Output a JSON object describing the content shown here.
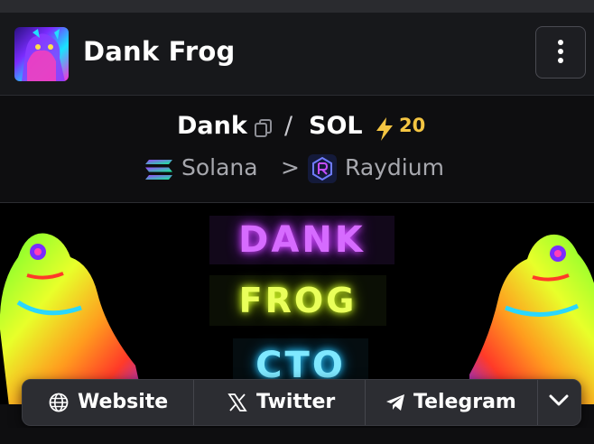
{
  "header": {
    "token_name": "Dank Frog",
    "avatar_icon": "dank-frog-avatar",
    "menu_icon": "more-vertical-icon"
  },
  "pair": {
    "base": "Dank",
    "separator": "/",
    "quote": "SOL",
    "boost_count": "20",
    "boost_color": "#f4c542",
    "copy_icon": "copy-icon",
    "boost_icon": "lightning-bolt-icon"
  },
  "chain": {
    "name": "Solana",
    "chevron": ">",
    "dex": "Raydium",
    "chain_icon": "solana-icon",
    "dex_icon": "raydium-icon"
  },
  "banner": {
    "lines": [
      "DANK",
      "FROG",
      "CTO"
    ],
    "colors": [
      "#d66bff",
      "#e9ff5a",
      "#7fe8ff"
    ]
  },
  "links": {
    "website": "Website",
    "twitter": "Twitter",
    "telegram": "Telegram",
    "more_icon": "chevron-down-icon"
  },
  "colors": {
    "background": "#0e0e10",
    "header_bg": "#17181b",
    "muted_text": "#a7a8ae",
    "links_bar_bg": "#2c2d32"
  }
}
